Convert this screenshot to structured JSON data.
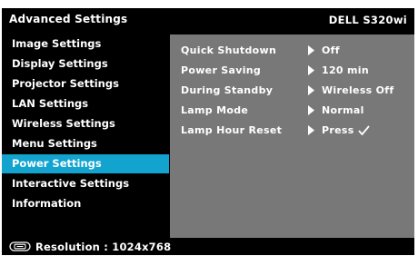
{
  "header": {
    "title": "Advanced Settings",
    "model": "DELL S320wi"
  },
  "sidebar": {
    "items": [
      {
        "label": "Image Settings",
        "selected": false
      },
      {
        "label": "Display Settings",
        "selected": false
      },
      {
        "label": "Projector Settings",
        "selected": false
      },
      {
        "label": "LAN Settings",
        "selected": false
      },
      {
        "label": "Wireless Settings",
        "selected": false
      },
      {
        "label": "Menu Settings",
        "selected": false
      },
      {
        "label": "Power Settings",
        "selected": true
      },
      {
        "label": "Interactive Settings",
        "selected": false
      },
      {
        "label": "Information",
        "selected": false
      }
    ]
  },
  "panel": {
    "rows": [
      {
        "name": "Quick Shutdown",
        "value": "Off"
      },
      {
        "name": "Power Saving",
        "value": "120 min"
      },
      {
        "name": "During Standby",
        "value": "Wireless Off"
      },
      {
        "name": "Lamp Mode",
        "value": "Normal"
      },
      {
        "name": "Lamp Hour Reset",
        "value": "Press",
        "icon": "checkmark-icon"
      }
    ],
    "arrow_icon": "triangle-right-icon"
  },
  "footer": {
    "icon": "resolution-icon",
    "resolution_text": "Resolution : 1024x768"
  },
  "colors": {
    "background": "#000000",
    "selected": "#12a3cf",
    "panel": "#787878",
    "text": "#ffffff"
  }
}
